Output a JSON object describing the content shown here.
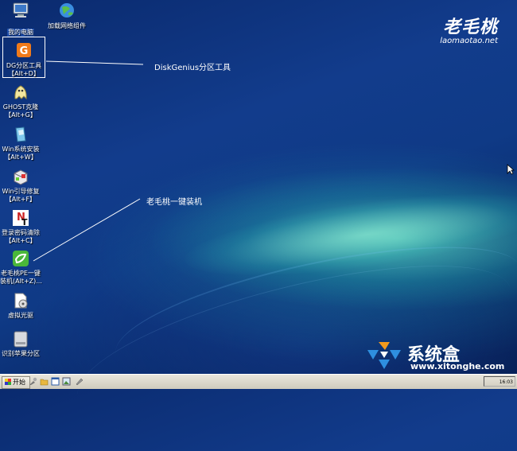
{
  "desktop_icons": [
    {
      "name": "my-computer",
      "label": "我的电脑",
      "icon": "computer-icon"
    },
    {
      "name": "load-network",
      "label": "加载网络组件",
      "icon": "network-globe-icon"
    },
    {
      "name": "diskgenius",
      "label": "DG分区工具",
      "label2": "【Alt+D】",
      "icon": "diskgenius-icon"
    },
    {
      "name": "ghost",
      "label": "GHOST克隆",
      "label2": "【Alt+G】",
      "icon": "ghost-icon"
    },
    {
      "name": "win-install",
      "label": "Win系统安装",
      "label2": "【Alt+W】",
      "icon": "install-box-icon"
    },
    {
      "name": "win-boot-repair",
      "label": "Win引导修复",
      "label2": "【Alt+F】",
      "icon": "boot-repair-icon"
    },
    {
      "name": "password-clear",
      "label": "登录密码清除",
      "label2": "【Alt+C】",
      "icon": "nt-password-icon"
    },
    {
      "name": "laomaotao-pe",
      "label": "老毛桃PE一键",
      "label2": "装机(Alt+Z)...",
      "icon": "pe-install-icon"
    },
    {
      "name": "virtual-cd",
      "label": "虚拟光驱",
      "icon": "cd-drive-icon"
    },
    {
      "name": "apple-partition",
      "label": "识别苹果分区",
      "icon": "apple-disk-icon"
    }
  ],
  "callouts": {
    "diskgenius": "DiskGenius分区工具",
    "oneclick": "老毛桃一键装机"
  },
  "logo": {
    "cn": "老毛桃",
    "en": "laomaotao.net"
  },
  "brand": {
    "cn": "系统盒",
    "url": "www.xitonghe.com"
  },
  "taskbar": {
    "start_label": "开始",
    "tray_text": "16:03"
  },
  "colors": {
    "desktop": "#0f3a86",
    "taskbar": "#d8d4c8"
  }
}
